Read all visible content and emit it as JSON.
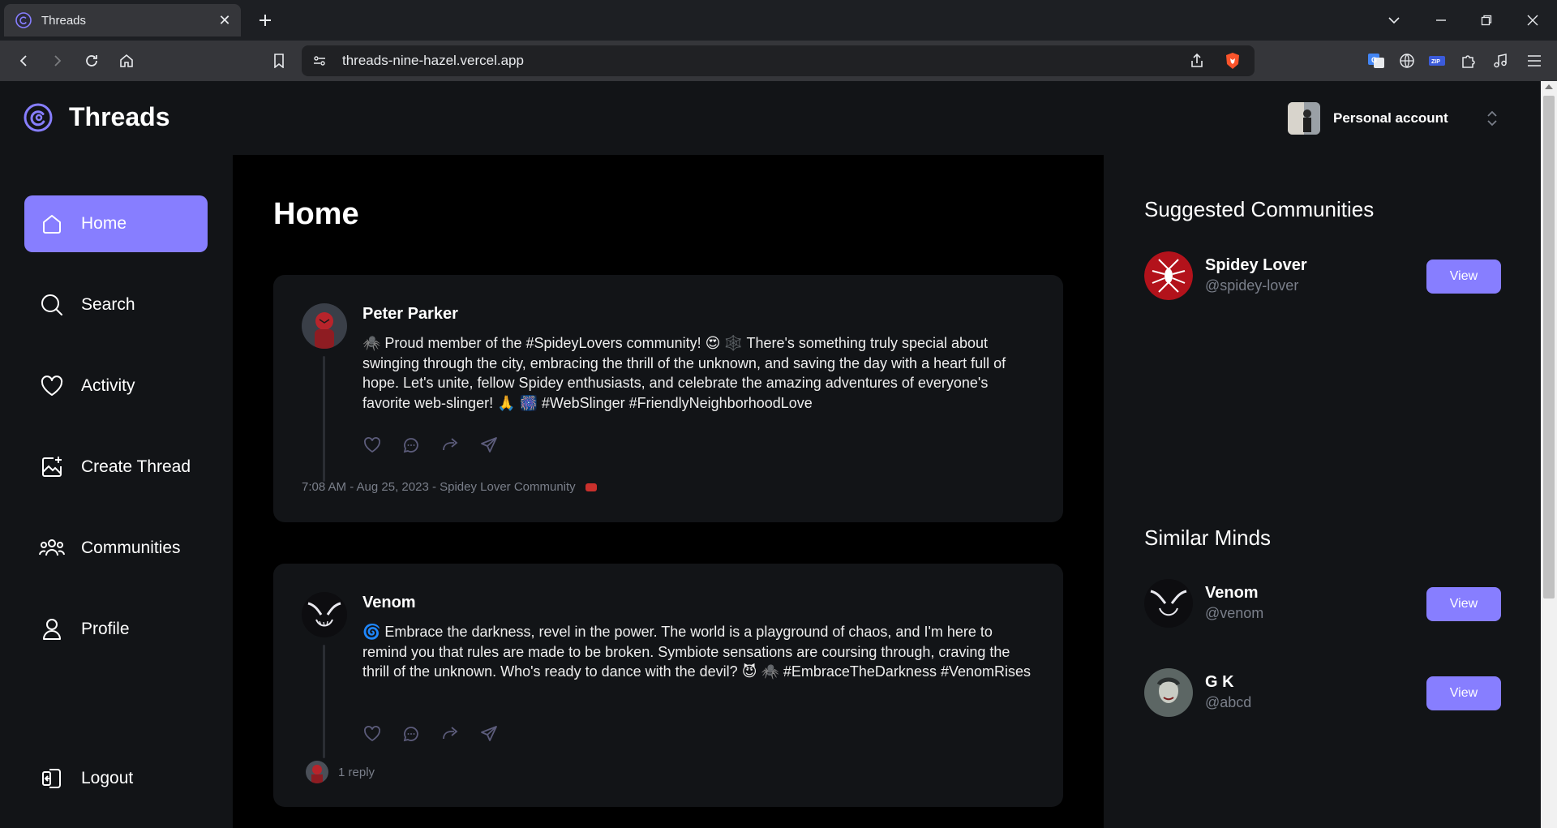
{
  "browser": {
    "tab_title": "Threads",
    "url": "threads-nine-hazel.vercel.app"
  },
  "app": {
    "brand": "Threads",
    "account_label": "Personal account"
  },
  "nav": {
    "items": [
      {
        "label": "Home",
        "icon": "home-icon",
        "active": true
      },
      {
        "label": "Search",
        "icon": "search-icon"
      },
      {
        "label": "Activity",
        "icon": "heart-icon"
      },
      {
        "label": "Create Thread",
        "icon": "create-thread-icon"
      },
      {
        "label": "Communities",
        "icon": "communities-icon"
      },
      {
        "label": "Profile",
        "icon": "profile-icon"
      }
    ],
    "logout": "Logout"
  },
  "main": {
    "title": "Home",
    "posts": [
      {
        "author": "Peter Parker",
        "content": "🕷️ Proud member of the #SpideyLovers community! 😍 🕸️ There's something truly special about swinging through the city, embracing the thrill of the unknown, and saving the day with a heart full of hope. Let's unite, fellow Spidey enthusiasts, and celebrate the amazing adventures of everyone's favorite web-slinger! 🙏 🎆 #WebSlinger #FriendlyNeighborhoodLove",
        "meta": "7:08 AM - Aug 25, 2023 - Spidey Lover Community"
      },
      {
        "author": "Venom",
        "content": "🌀 Embrace the darkness, revel in the power. The world is a playground of chaos, and I'm here to remind you that rules are made to be broken. Symbiote sensations are coursing through, craving the thrill of the unknown. Who's ready to dance with the devil? 😈 🕷️ #EmbraceTheDarkness #VenomRises",
        "replies": "1 reply"
      }
    ]
  },
  "right": {
    "communities_title": "Suggested Communities",
    "communities": [
      {
        "name": "Spidey Lover",
        "handle": "@spidey-lover",
        "button": "View"
      }
    ],
    "minds_title": "Similar Minds",
    "minds": [
      {
        "name": "Venom",
        "handle": "@venom",
        "button": "View"
      },
      {
        "name": "G K",
        "handle": "@abcd",
        "button": "View"
      }
    ]
  },
  "colors": {
    "accent": "#877eff",
    "background": "#121417",
    "main_background": "#000000",
    "muted_text": "#7a7f8a"
  }
}
